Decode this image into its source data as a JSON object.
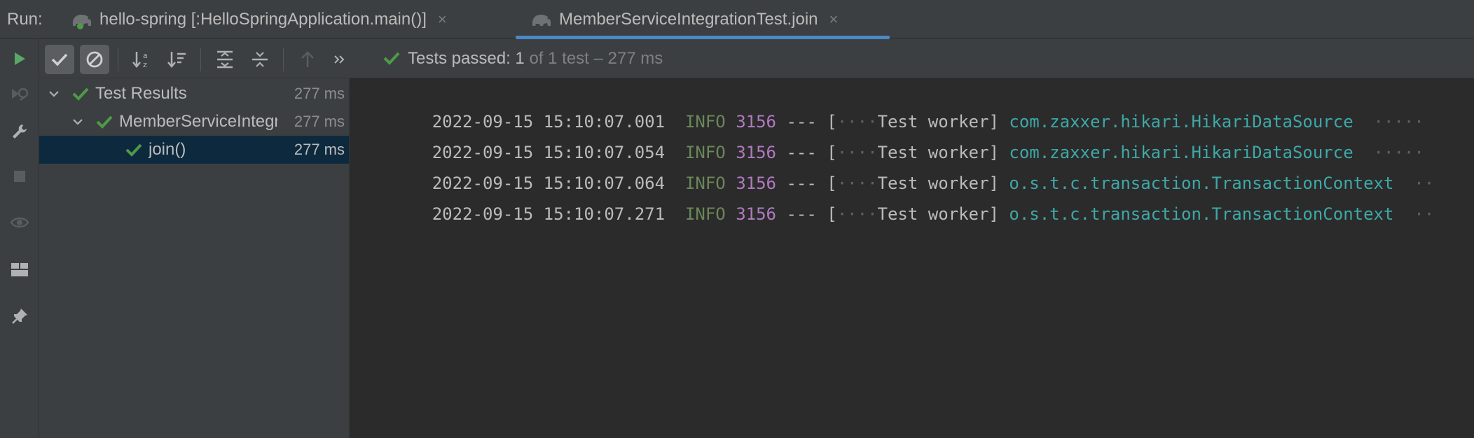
{
  "run_label": "Run:",
  "tabs": [
    {
      "label": "hello-spring [:HelloSpringApplication.main()]",
      "icon": "gradle-elephant-icon",
      "active": false
    },
    {
      "label": "MemberServiceIntegrationTest.join",
      "icon": "gradle-elephant-icon",
      "active": true
    }
  ],
  "tab_close_glyph": "×",
  "status": {
    "passed_label": "Tests passed: ",
    "passed_count": "1",
    "rest": " of 1 test – 277 ms"
  },
  "tree": [
    {
      "label": "Test Results",
      "time": "277 ms",
      "status": "passed",
      "expanded": true
    },
    {
      "label": "MemberServiceIntegrationTest",
      "time": "277 ms",
      "status": "passed",
      "expanded": true
    },
    {
      "label": "join()",
      "time": "277 ms",
      "status": "passed",
      "selected": true
    }
  ],
  "console": [
    {
      "timestamp": "2022-09-15 15:10:07.001",
      "level": "INFO",
      "pid": "3156",
      "sep": "---",
      "thread": "Test worker",
      "logger": "com.zaxxer.hikari.HikariDataSource"
    },
    {
      "timestamp": "2022-09-15 15:10:07.054",
      "level": "INFO",
      "pid": "3156",
      "sep": "---",
      "thread": "Test worker",
      "logger": "com.zaxxer.hikari.HikariDataSource"
    },
    {
      "timestamp": "2022-09-15 15:10:07.064",
      "level": "INFO",
      "pid": "3156",
      "sep": "---",
      "thread": "Test worker",
      "logger": "o.s.t.c.transaction.TransactionContext"
    },
    {
      "timestamp": "2022-09-15 15:10:07.271",
      "level": "INFO",
      "pid": "3156",
      "sep": "---",
      "thread": "Test worker",
      "logger": "o.s.t.c.transaction.TransactionContext"
    }
  ],
  "colors": {
    "accent": "#4a88c7",
    "pass_green": "#4e9a48",
    "log_level": "#6a8759",
    "pid": "#b07ac0",
    "logger": "#3fa8a8",
    "selection": "#0d293e"
  }
}
